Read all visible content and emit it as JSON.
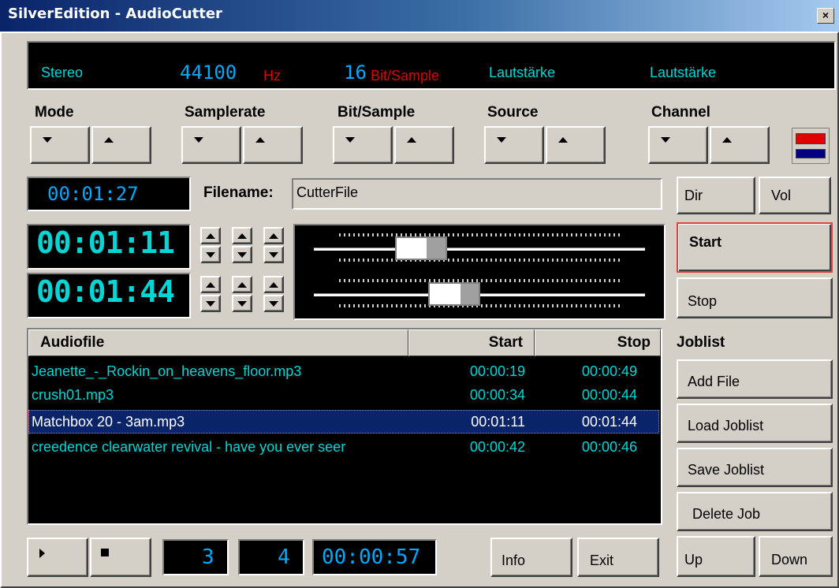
{
  "window": {
    "title": "SilverEdition - AudioCutter",
    "close_label": "×"
  },
  "status": {
    "mode": "Stereo",
    "samplerate_value": "44100",
    "samplerate_unit": "Hz",
    "bits_value": "16",
    "bits_unit": "Bit/Sample",
    "volume_left": "Lautstärke",
    "volume_right": "Lautstärke"
  },
  "selectors": {
    "mode": "Mode",
    "samplerate": "Samplerate",
    "bitsample": "Bit/Sample",
    "source": "Source",
    "channel": "Channel"
  },
  "length_display": "00:01:27",
  "filename": {
    "label": "Filename:",
    "value": "CutterFile"
  },
  "start_time": "00:01:11",
  "stop_time": "00:01:44",
  "sliders": {
    "start_position": 0.29,
    "stop_position": 0.41
  },
  "buttons": {
    "dir": "Dir",
    "vol": "Vol",
    "start": "Start",
    "stop": "Stop",
    "add_file": "Add File",
    "load_joblist": "Load Joblist",
    "save_joblist": "Save Joblist",
    "delete_job": "Delete Job",
    "up": "Up",
    "down": "Down",
    "info": "Info",
    "exit": "Exit"
  },
  "joblist_label": "Joblist",
  "table": {
    "headers": {
      "file": "Audiofile",
      "start": "Start",
      "stop": "Stop"
    },
    "rows": [
      {
        "file": "Jeanette_-_Rockin_on_heavens_floor.mp3",
        "start": "00:00:19",
        "stop": "00:00:49"
      },
      {
        "file": "crush01.mp3",
        "start": "00:00:34",
        "stop": "00:00:44"
      },
      {
        "file": "Matchbox 20 - 3am.mp3",
        "start": "00:01:11",
        "stop": "00:01:44"
      },
      {
        "file": "creedence clearwater revival - have you ever seer",
        "start": "00:00:42",
        "stop": "00:00:46"
      }
    ],
    "selected_row": 2
  },
  "transport": {
    "current_job": "3",
    "total_jobs": "4",
    "position": "00:00:57"
  },
  "colors": {
    "lcd_cyan": "#00d6d6",
    "lcd_blue": "#00aaff",
    "lcd_red": "#e00000",
    "selection": "#0a246a",
    "channel_left": "#e00000",
    "channel_right": "#000080"
  }
}
